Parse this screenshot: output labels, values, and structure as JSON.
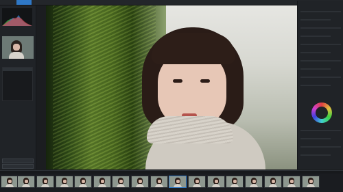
{
  "app": {
    "title": ""
  },
  "window": {
    "tab_label": "",
    "top_controls": [],
    "right_label": ""
  },
  "left_panel": {},
  "photo": {
    "desc": ""
  },
  "right_panel": {},
  "filmstrip": {
    "status_left": "",
    "status_mid": "",
    "thumbs": [
      "",
      "",
      "",
      "",
      "",
      "",
      "",
      "",
      "",
      "",
      "",
      "",
      "",
      "",
      "",
      "",
      ""
    ]
  }
}
